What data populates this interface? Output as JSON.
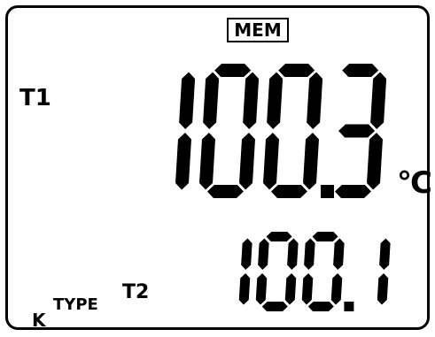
{
  "display": {
    "mem_label": "MEM",
    "t1_label": "T1",
    "t2_label": "T2",
    "unit": "°C",
    "type_label": "TYPE",
    "thermocouple_type": "K"
  },
  "readings": {
    "t1": "100.3",
    "t2": "100.1"
  },
  "colors": {
    "segment": "#000000",
    "background": "#ffffff"
  }
}
